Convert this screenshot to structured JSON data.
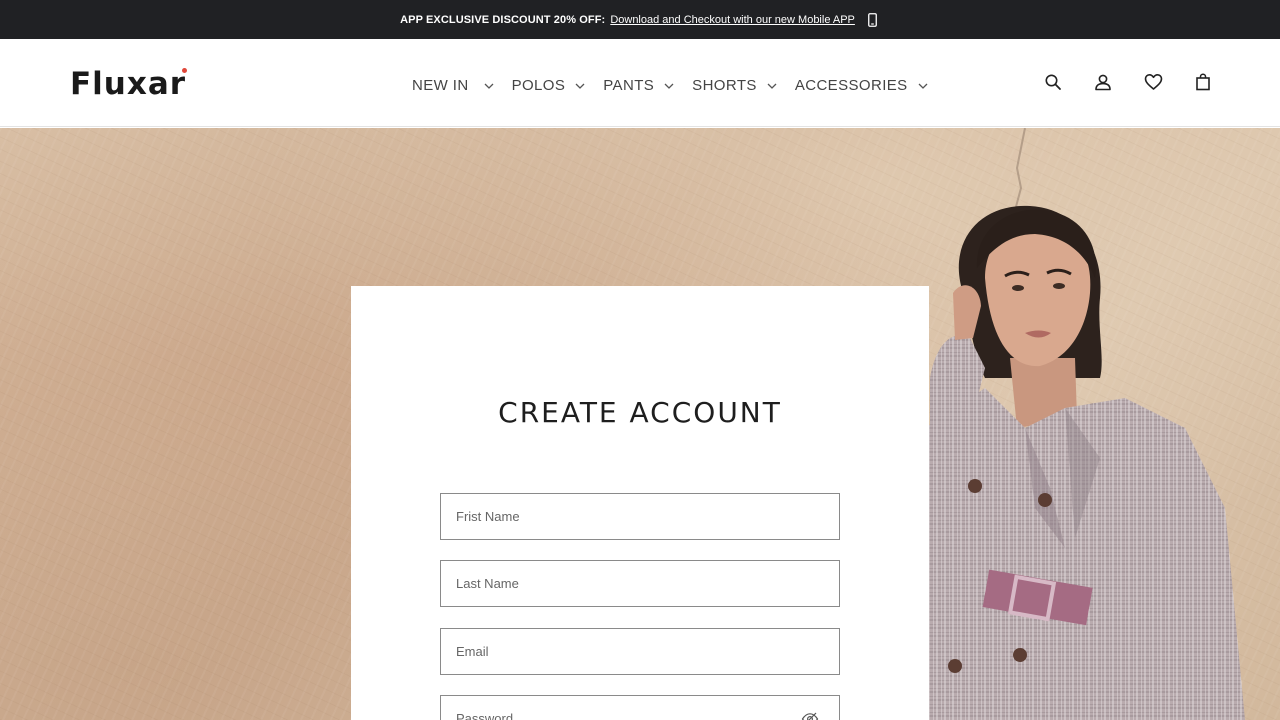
{
  "announcement": {
    "promo_text": "APP EXCLUSIVE DISCOUNT 20% OFF:",
    "link_text": "Download and Checkout with our new Mobile APP",
    "icon": "mobile-phone-icon"
  },
  "header": {
    "logo": "Fluxar",
    "nav": [
      {
        "label": "NEW IN",
        "icon": "chevron-down-icon"
      },
      {
        "label": "POLOS",
        "icon": "chevron-down-icon"
      },
      {
        "label": "PANTS",
        "icon": "chevron-down-icon"
      },
      {
        "label": "SHORTS",
        "icon": "chevron-down-icon"
      },
      {
        "label": "ACCESSORIES",
        "icon": "chevron-down-icon"
      }
    ],
    "icons": [
      "search-icon",
      "account-icon",
      "wishlist-heart-icon",
      "shopping-bag-icon"
    ]
  },
  "form": {
    "title": "CREATE ACCOUNT",
    "first_name": {
      "placeholder": "Frist Name",
      "value": ""
    },
    "last_name": {
      "placeholder": "Last Name",
      "value": ""
    },
    "email": {
      "placeholder": "Email",
      "value": ""
    },
    "password": {
      "placeholder": "Password",
      "value": "",
      "icon": "eye-slash-icon"
    }
  },
  "colors": {
    "topbar_bg": "#202124",
    "logo_accent": "#e0473a",
    "hero_bg": "#d4b99e",
    "field_border": "#8a8a8a"
  }
}
